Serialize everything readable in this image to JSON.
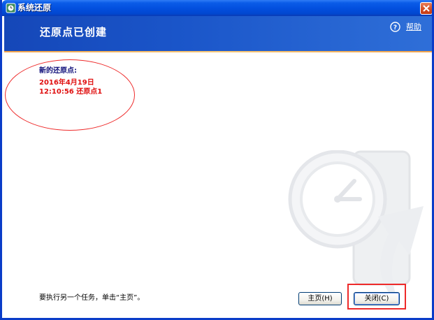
{
  "window": {
    "title": "系统还原"
  },
  "header": {
    "page_title": "还原点已创建",
    "help_label": "帮助"
  },
  "restore_point": {
    "label": "新的还原点:",
    "date": "2016年4月19日",
    "time_and_name": "12:10:56  还原点1"
  },
  "footer": {
    "hint": "要执行另一个任务，单击“主页”。",
    "home_button": "主页(H)",
    "close_button": "关闭(C)"
  },
  "colors": {
    "header_blue": "#1a55c9",
    "title_bar_blue": "#0350df",
    "accent_orange": "#f1a24a",
    "annotation_red": "#ee2a2a",
    "restore_point_red": "#e01010"
  }
}
